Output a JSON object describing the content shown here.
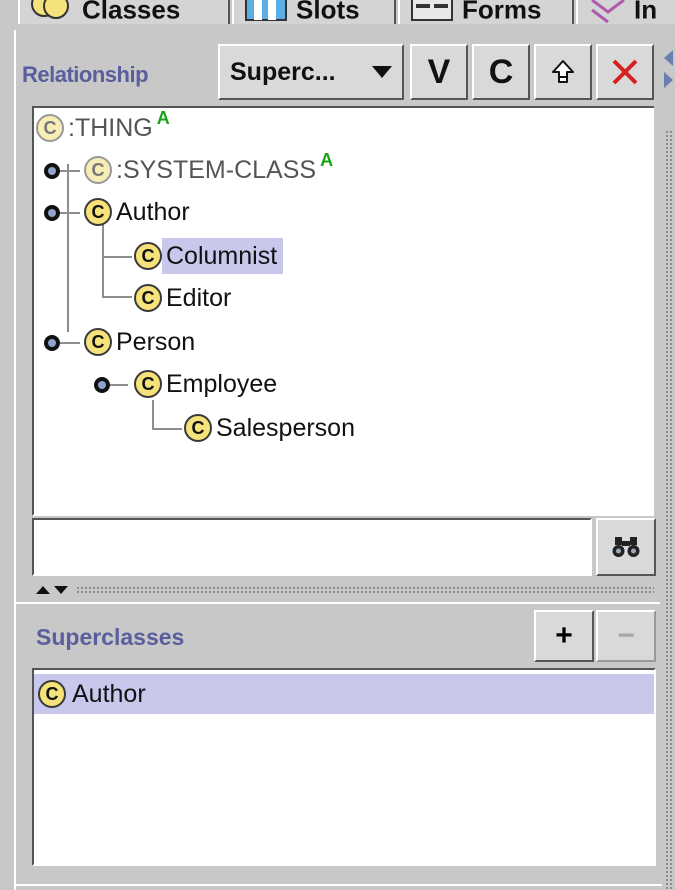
{
  "tabs": [
    {
      "label": "Classes"
    },
    {
      "label": "Slots"
    },
    {
      "label": "Forms"
    },
    {
      "label": "In"
    }
  ],
  "header": {
    "relationship_label": "Relationship",
    "relationship_select": "Superc...",
    "btn_v": "V",
    "btn_c": "C"
  },
  "tree": {
    "icon_letter": "C",
    "badge": "A",
    "nodes": [
      {
        "label": ":THING",
        "badge": "A"
      },
      {
        "label": ":SYSTEM-CLASS",
        "badge": "A"
      },
      {
        "label": "Author"
      },
      {
        "label": "Columnist",
        "selected": true
      },
      {
        "label": "Editor"
      },
      {
        "label": "Person"
      },
      {
        "label": "Employee"
      },
      {
        "label": "Salesperson"
      }
    ]
  },
  "search": {
    "value": ""
  },
  "superclasses": {
    "label": "Superclasses",
    "add": "+",
    "remove": "−",
    "items": [
      {
        "label": "Author"
      }
    ]
  },
  "colors": {
    "selection": "#c8c8ec",
    "label_accent": "#5a5e9c",
    "class_icon": "#f5e27a",
    "badge": "#16a316"
  }
}
